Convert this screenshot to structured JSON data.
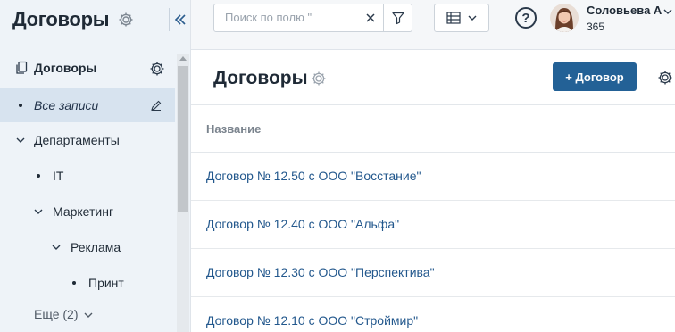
{
  "sidebar": {
    "title": "Договоры",
    "root_label": "Договоры",
    "items": [
      {
        "label": "Все записи"
      },
      {
        "label": "Департаменты"
      },
      {
        "label": "IT"
      },
      {
        "label": "Маркетинг"
      },
      {
        "label": "Реклама"
      },
      {
        "label": "Принт"
      }
    ],
    "more_label": "Еще (2)"
  },
  "topbar": {
    "search_placeholder": "Поиск по полю \"",
    "user_name": "Соловьева А",
    "user_sub": "365",
    "help_glyph": "?"
  },
  "main": {
    "title": "Договоры",
    "add_button": "+ Договор",
    "column_header": "Название",
    "rows": [
      {
        "name": "Договор № 12.50 с ООО \"Восстание\""
      },
      {
        "name": "Договор № 12.40 с ООО \"Альфа\""
      },
      {
        "name": "Договор № 12.30 с ООО \"Перспектива\""
      },
      {
        "name": "Договор № 12.10 с ООО \"Строймир\""
      }
    ]
  },
  "colors": {
    "accent": "#236196",
    "link": "#23588d",
    "sidebar_bg": "#eef3f8",
    "selected_bg": "#d7e3ef"
  },
  "icons": [
    "gear-icon",
    "collapse-icon",
    "documents-icon",
    "edit-icon",
    "chevron-down-icon",
    "clear-icon",
    "filter-icon",
    "table-view-icon",
    "help-icon"
  ]
}
